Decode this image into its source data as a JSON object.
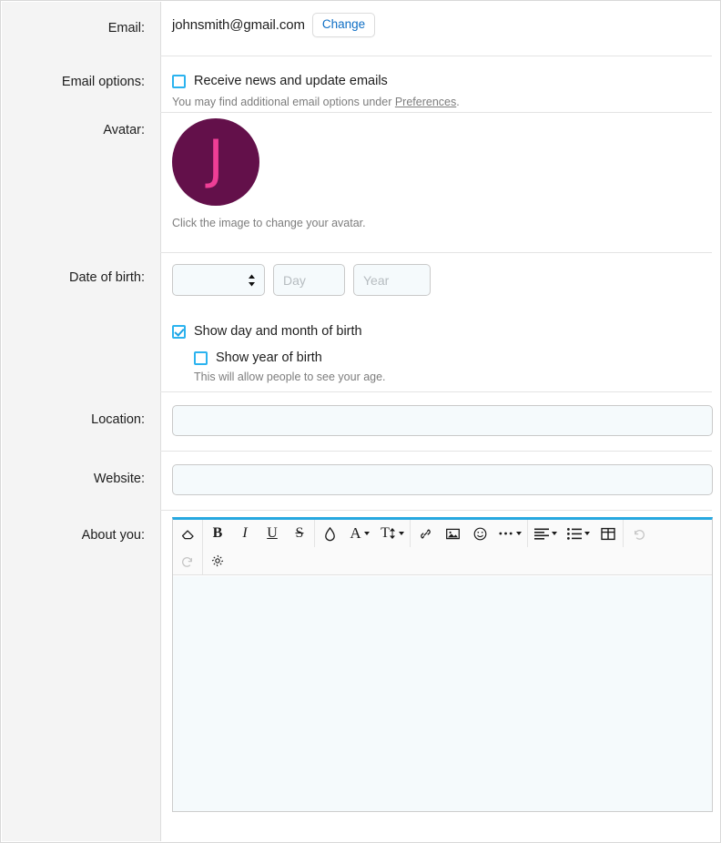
{
  "form": {
    "rows": [
      {
        "label": "Email:"
      },
      {
        "label": "Email options:"
      },
      {
        "label": "Avatar:"
      },
      {
        "label": "Date of birth:"
      },
      {
        "label": "Location:"
      },
      {
        "label": "Website:"
      },
      {
        "label": "About you:"
      }
    ]
  },
  "email": {
    "label": "Email:",
    "value": "johnsmith@gmail.com",
    "change_button": "Change"
  },
  "email_options": {
    "label": "Email options:",
    "newsletter_label": "Receive news and update emails",
    "newsletter_checked": false,
    "hint_prefix": "You may find additional email options under ",
    "hint_link": "Preferences",
    "hint_suffix": "."
  },
  "avatar": {
    "label": "Avatar:",
    "initial": "J",
    "background_color": "#63104a",
    "initial_color": "#ef3e96",
    "hint": "Click the image to change your avatar."
  },
  "date_of_birth": {
    "label": "Date of birth:",
    "month_value": "",
    "month_placeholder": "",
    "day_placeholder": "Day",
    "day_value": "",
    "year_placeholder": "Year",
    "year_value": "",
    "show_day_month_label": "Show day and month of birth",
    "show_day_month_checked": true,
    "show_year_label": "Show year of birth",
    "show_year_checked": false,
    "show_year_hint": "This will allow people to see your age."
  },
  "location": {
    "label": "Location:",
    "value": "",
    "placeholder": ""
  },
  "website": {
    "label": "Website:",
    "value": "",
    "placeholder": ""
  },
  "about": {
    "label": "About you:",
    "content": "",
    "accent_color": "#27a8e0",
    "toolbar": {
      "row1": [
        {
          "icon": "eraser-icon",
          "glyph": "◇",
          "name": "clear-formatting-button",
          "caret": false,
          "disabled": false,
          "group_end": true
        },
        {
          "icon": "bold-icon",
          "glyph": "B",
          "name": "bold-button",
          "caret": false,
          "disabled": false,
          "group_end": false
        },
        {
          "icon": "italic-icon",
          "glyph": "I",
          "name": "italic-button",
          "caret": false,
          "disabled": false,
          "group_end": false
        },
        {
          "icon": "underline-icon",
          "glyph": "U",
          "name": "underline-button",
          "caret": false,
          "disabled": false,
          "group_end": false
        },
        {
          "icon": "strikethrough-icon",
          "glyph": "S",
          "name": "strikethrough-button",
          "caret": false,
          "disabled": false,
          "group_end": true
        },
        {
          "icon": "text-color-droplet-icon",
          "glyph": "◇",
          "name": "text-color-button",
          "caret": false,
          "disabled": false,
          "group_end": false
        },
        {
          "icon": "background-color-icon",
          "glyph": "A",
          "name": "background-color-button",
          "caret": true,
          "disabled": false,
          "group_end": false
        },
        {
          "icon": "font-size-icon",
          "glyph": "T",
          "name": "font-size-button",
          "caret": true,
          "disabled": false,
          "group_end": true
        },
        {
          "icon": "link-icon",
          "glyph": "🔗",
          "name": "insert-link-button",
          "caret": false,
          "disabled": false,
          "group_end": false
        },
        {
          "icon": "image-icon",
          "glyph": "🏞",
          "name": "insert-image-button",
          "caret": false,
          "disabled": false,
          "group_end": false
        },
        {
          "icon": "emoji-icon",
          "glyph": "☺",
          "name": "insert-emoji-button",
          "caret": false,
          "disabled": false,
          "group_end": false
        },
        {
          "icon": "more-options-icon",
          "glyph": "⋯",
          "name": "more-options-button",
          "caret": true,
          "disabled": false,
          "group_end": true
        },
        {
          "icon": "align-icon",
          "glyph": "≡",
          "name": "align-button",
          "caret": true,
          "disabled": false,
          "group_end": false
        },
        {
          "icon": "list-icon",
          "glyph": "☰",
          "name": "list-button",
          "caret": true,
          "disabled": false,
          "group_end": false
        },
        {
          "icon": "table-icon",
          "glyph": "⊞",
          "name": "insert-table-button",
          "caret": false,
          "disabled": false,
          "group_end": true
        },
        {
          "icon": "undo-icon",
          "glyph": "↶",
          "name": "undo-button",
          "caret": false,
          "disabled": true,
          "group_end": false
        }
      ],
      "row2": [
        {
          "icon": "redo-icon",
          "glyph": "↷",
          "name": "redo-button",
          "caret": false,
          "disabled": true,
          "group_end": true
        },
        {
          "icon": "gear-icon",
          "glyph": "⚙",
          "name": "editor-settings-button",
          "caret": false,
          "disabled": false,
          "group_end": false
        }
      ]
    }
  }
}
